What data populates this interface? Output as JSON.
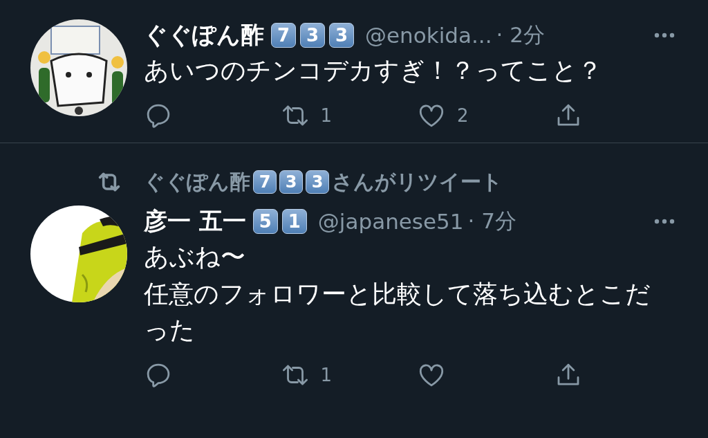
{
  "tweets": [
    {
      "name": "ぐぐぽん酢",
      "badges": [
        "7",
        "3",
        "3"
      ],
      "handle": "@enokida...",
      "time": "· 2分",
      "text": [
        "あいつのチンコデカすぎ！？ってこと？"
      ],
      "retweets": "1",
      "likes": "2",
      "avatar": {
        "kind": "picture"
      }
    },
    {
      "retweeted_by": {
        "name": "ぐぐぽん酢",
        "badges": [
          "7",
          "3",
          "3"
        ],
        "suffix": "さんがリツイート"
      },
      "name": "彦一 五一",
      "badges": [
        "5",
        "1"
      ],
      "handle": "@japanese51",
      "time": "· 7分",
      "text": [
        "あぶね〜",
        "任意のフォロワーと比較して落ち込むとこだった"
      ],
      "retweets": "1",
      "avatar": {
        "kind": "picture"
      }
    }
  ]
}
